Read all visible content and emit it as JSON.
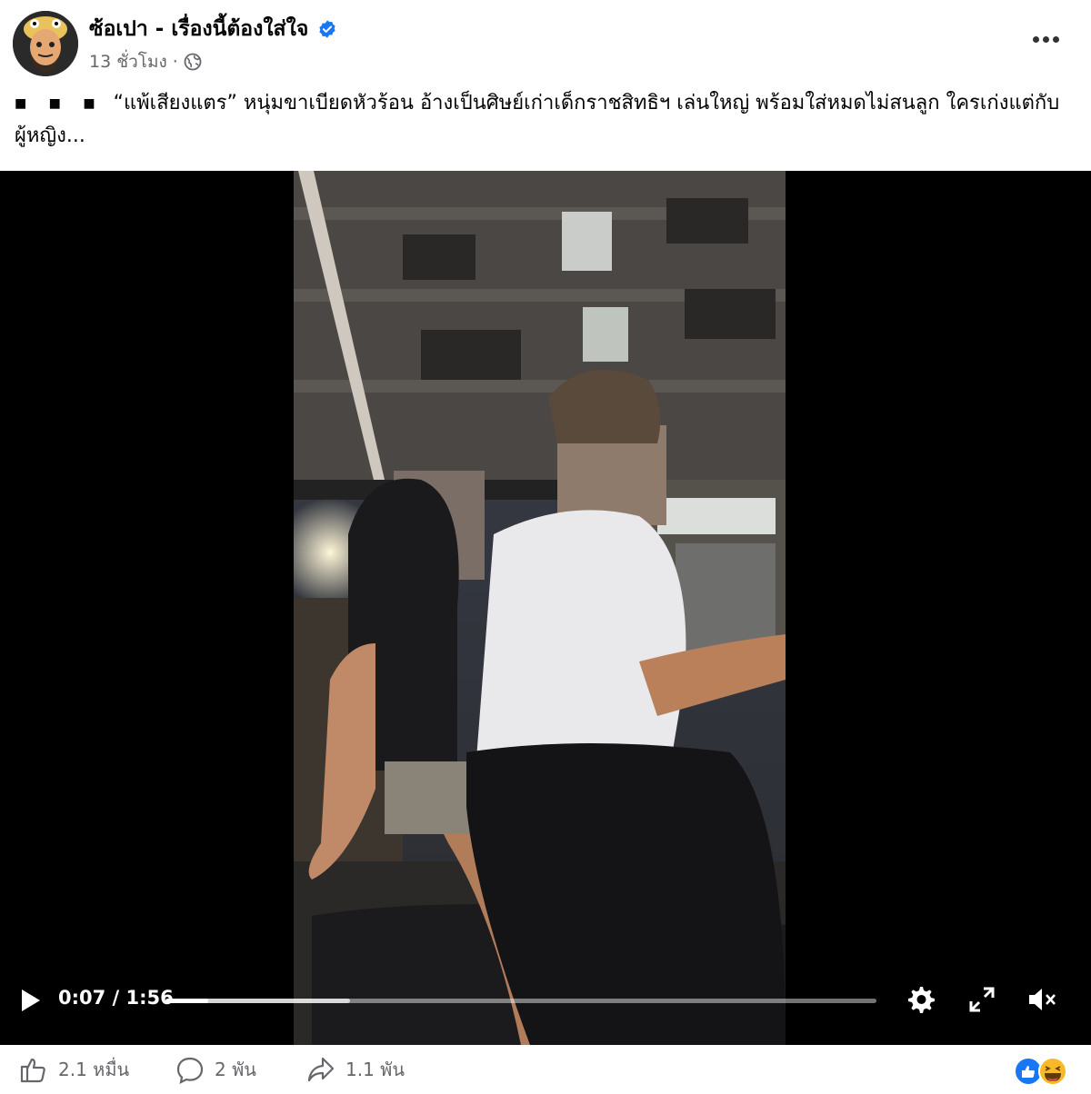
{
  "post": {
    "page_name": "ซ้อเปา - เรื่องนี้ต้องใส่ใจ",
    "time_ago": "13 ชั่วโมง",
    "separator": "·",
    "caption_bullets": "■ ■ ■",
    "caption_text": "“แพ้เสียงแตร” หนุ่มขาเบียดหัวร้อน อ้างเป็นศิษย์เก่าเด็กราชสิทธิฯ เล่นใหญ่ พร้อมใส่หมดไม่สนลูก ใครเก่งแต่กับผู้หญิง..."
  },
  "video": {
    "current_time": "0:07",
    "time_sep": "/",
    "duration": "1:56",
    "progress_fraction": 0.06,
    "buffered_fraction": 0.26
  },
  "footer": {
    "likes": "2.1 หมื่น",
    "comments": "2 พัน",
    "shares": "1.1 พัน"
  },
  "colors": {
    "verified": "#1877f2",
    "meta_text": "#65676b",
    "like_blue": "#1877f2",
    "haha_yellow": "#f7b928"
  }
}
